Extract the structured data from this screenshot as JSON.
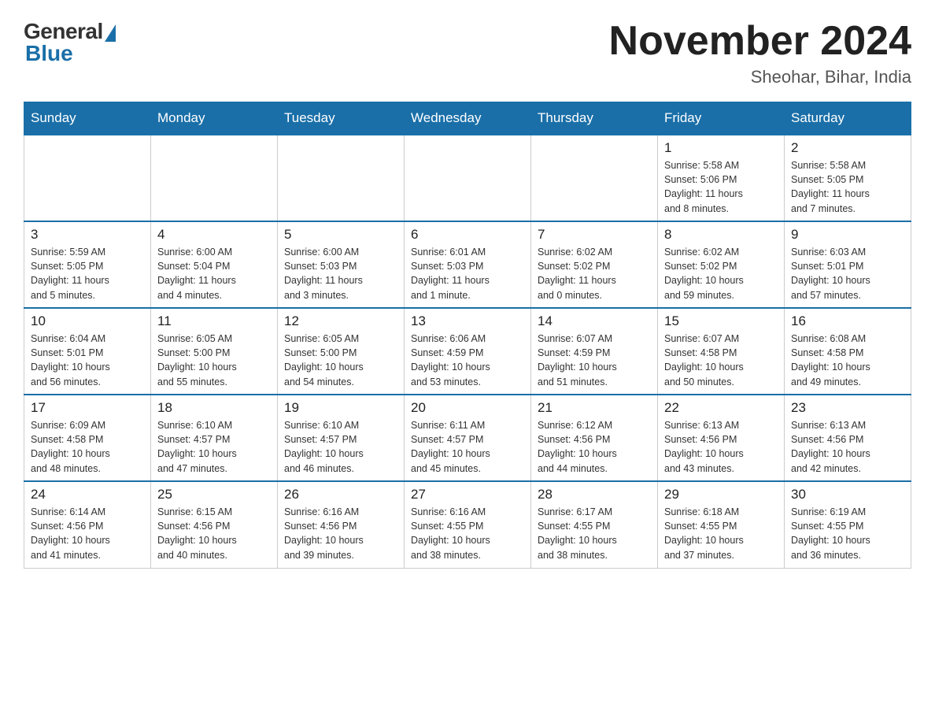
{
  "header": {
    "logo_general": "General",
    "logo_blue": "Blue",
    "month_title": "November 2024",
    "location": "Sheohar, Bihar, India"
  },
  "days_of_week": [
    "Sunday",
    "Monday",
    "Tuesday",
    "Wednesday",
    "Thursday",
    "Friday",
    "Saturday"
  ],
  "weeks": [
    {
      "days": [
        {
          "num": "",
          "info": ""
        },
        {
          "num": "",
          "info": ""
        },
        {
          "num": "",
          "info": ""
        },
        {
          "num": "",
          "info": ""
        },
        {
          "num": "",
          "info": ""
        },
        {
          "num": "1",
          "info": "Sunrise: 5:58 AM\nSunset: 5:06 PM\nDaylight: 11 hours\nand 8 minutes."
        },
        {
          "num": "2",
          "info": "Sunrise: 5:58 AM\nSunset: 5:05 PM\nDaylight: 11 hours\nand 7 minutes."
        }
      ]
    },
    {
      "days": [
        {
          "num": "3",
          "info": "Sunrise: 5:59 AM\nSunset: 5:05 PM\nDaylight: 11 hours\nand 5 minutes."
        },
        {
          "num": "4",
          "info": "Sunrise: 6:00 AM\nSunset: 5:04 PM\nDaylight: 11 hours\nand 4 minutes."
        },
        {
          "num": "5",
          "info": "Sunrise: 6:00 AM\nSunset: 5:03 PM\nDaylight: 11 hours\nand 3 minutes."
        },
        {
          "num": "6",
          "info": "Sunrise: 6:01 AM\nSunset: 5:03 PM\nDaylight: 11 hours\nand 1 minute."
        },
        {
          "num": "7",
          "info": "Sunrise: 6:02 AM\nSunset: 5:02 PM\nDaylight: 11 hours\nand 0 minutes."
        },
        {
          "num": "8",
          "info": "Sunrise: 6:02 AM\nSunset: 5:02 PM\nDaylight: 10 hours\nand 59 minutes."
        },
        {
          "num": "9",
          "info": "Sunrise: 6:03 AM\nSunset: 5:01 PM\nDaylight: 10 hours\nand 57 minutes."
        }
      ]
    },
    {
      "days": [
        {
          "num": "10",
          "info": "Sunrise: 6:04 AM\nSunset: 5:01 PM\nDaylight: 10 hours\nand 56 minutes."
        },
        {
          "num": "11",
          "info": "Sunrise: 6:05 AM\nSunset: 5:00 PM\nDaylight: 10 hours\nand 55 minutes."
        },
        {
          "num": "12",
          "info": "Sunrise: 6:05 AM\nSunset: 5:00 PM\nDaylight: 10 hours\nand 54 minutes."
        },
        {
          "num": "13",
          "info": "Sunrise: 6:06 AM\nSunset: 4:59 PM\nDaylight: 10 hours\nand 53 minutes."
        },
        {
          "num": "14",
          "info": "Sunrise: 6:07 AM\nSunset: 4:59 PM\nDaylight: 10 hours\nand 51 minutes."
        },
        {
          "num": "15",
          "info": "Sunrise: 6:07 AM\nSunset: 4:58 PM\nDaylight: 10 hours\nand 50 minutes."
        },
        {
          "num": "16",
          "info": "Sunrise: 6:08 AM\nSunset: 4:58 PM\nDaylight: 10 hours\nand 49 minutes."
        }
      ]
    },
    {
      "days": [
        {
          "num": "17",
          "info": "Sunrise: 6:09 AM\nSunset: 4:58 PM\nDaylight: 10 hours\nand 48 minutes."
        },
        {
          "num": "18",
          "info": "Sunrise: 6:10 AM\nSunset: 4:57 PM\nDaylight: 10 hours\nand 47 minutes."
        },
        {
          "num": "19",
          "info": "Sunrise: 6:10 AM\nSunset: 4:57 PM\nDaylight: 10 hours\nand 46 minutes."
        },
        {
          "num": "20",
          "info": "Sunrise: 6:11 AM\nSunset: 4:57 PM\nDaylight: 10 hours\nand 45 minutes."
        },
        {
          "num": "21",
          "info": "Sunrise: 6:12 AM\nSunset: 4:56 PM\nDaylight: 10 hours\nand 44 minutes."
        },
        {
          "num": "22",
          "info": "Sunrise: 6:13 AM\nSunset: 4:56 PM\nDaylight: 10 hours\nand 43 minutes."
        },
        {
          "num": "23",
          "info": "Sunrise: 6:13 AM\nSunset: 4:56 PM\nDaylight: 10 hours\nand 42 minutes."
        }
      ]
    },
    {
      "days": [
        {
          "num": "24",
          "info": "Sunrise: 6:14 AM\nSunset: 4:56 PM\nDaylight: 10 hours\nand 41 minutes."
        },
        {
          "num": "25",
          "info": "Sunrise: 6:15 AM\nSunset: 4:56 PM\nDaylight: 10 hours\nand 40 minutes."
        },
        {
          "num": "26",
          "info": "Sunrise: 6:16 AM\nSunset: 4:56 PM\nDaylight: 10 hours\nand 39 minutes."
        },
        {
          "num": "27",
          "info": "Sunrise: 6:16 AM\nSunset: 4:55 PM\nDaylight: 10 hours\nand 38 minutes."
        },
        {
          "num": "28",
          "info": "Sunrise: 6:17 AM\nSunset: 4:55 PM\nDaylight: 10 hours\nand 38 minutes."
        },
        {
          "num": "29",
          "info": "Sunrise: 6:18 AM\nSunset: 4:55 PM\nDaylight: 10 hours\nand 37 minutes."
        },
        {
          "num": "30",
          "info": "Sunrise: 6:19 AM\nSunset: 4:55 PM\nDaylight: 10 hours\nand 36 minutes."
        }
      ]
    }
  ]
}
